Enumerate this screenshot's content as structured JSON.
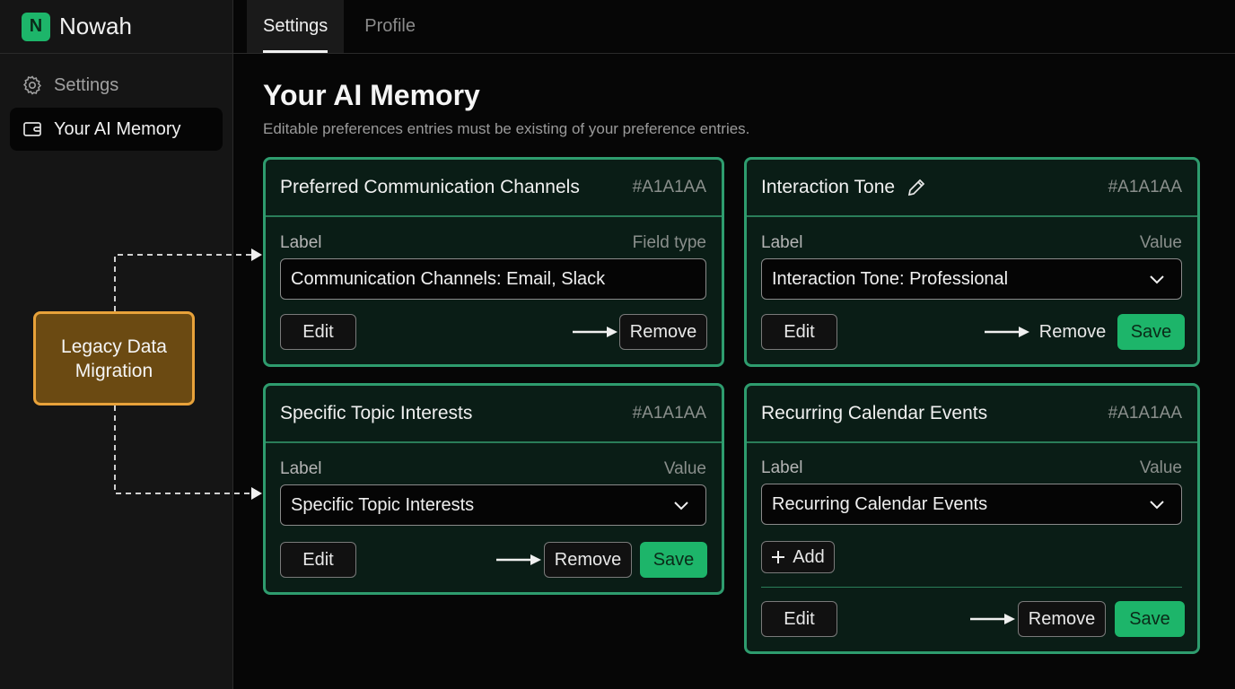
{
  "app": {
    "logo_letter": "N",
    "name": "Nowah"
  },
  "sidebar": {
    "items": [
      {
        "label": "Settings",
        "icon": "gear-icon"
      },
      {
        "label": "Your AI Memory",
        "icon": "wallet-icon"
      }
    ]
  },
  "tabs": [
    {
      "label": "Settings"
    },
    {
      "label": "Profile"
    }
  ],
  "page": {
    "title": "Your AI Memory",
    "subtitle": "Editable preferences entries must be existing of your preference entries."
  },
  "legacy_box": {
    "line1": "Legacy Data",
    "line2": "Migration"
  },
  "cards": [
    {
      "title": "Preferred Communication Channels",
      "code": "#A1A1AA",
      "field_label": "Label",
      "field_right": "Field type",
      "value": "Communication Channels: Email, Slack",
      "edit": "Edit",
      "remove": "Remove"
    },
    {
      "title": "Interaction Tone",
      "code": "#A1A1AA",
      "field_label": "Label",
      "field_right": "Value",
      "value": "Interaction Tone: Professional",
      "edit": "Edit",
      "remove": "Remove",
      "save": "Save"
    },
    {
      "title": "Specific Topic Interests",
      "code": "#A1A1AA",
      "field_label": "Label",
      "field_right": "Value",
      "value": "Specific Topic Interests",
      "edit": "Edit",
      "remove": "Remove",
      "save": "Save"
    },
    {
      "title": "Recurring Calendar Events",
      "code": "#A1A1AA",
      "field_label": "Label",
      "field_right": "Value",
      "value": "Recurring Calendar Events",
      "add": "Add",
      "edit": "Edit",
      "remove": "Remove",
      "save": "Save"
    }
  ],
  "colors": {
    "accent": "#1db56a",
    "card_border": "#2e9c6e",
    "card_bg": "#0a1d16",
    "legacy_fill": "#6b4a12",
    "legacy_border": "#e8a23a"
  }
}
